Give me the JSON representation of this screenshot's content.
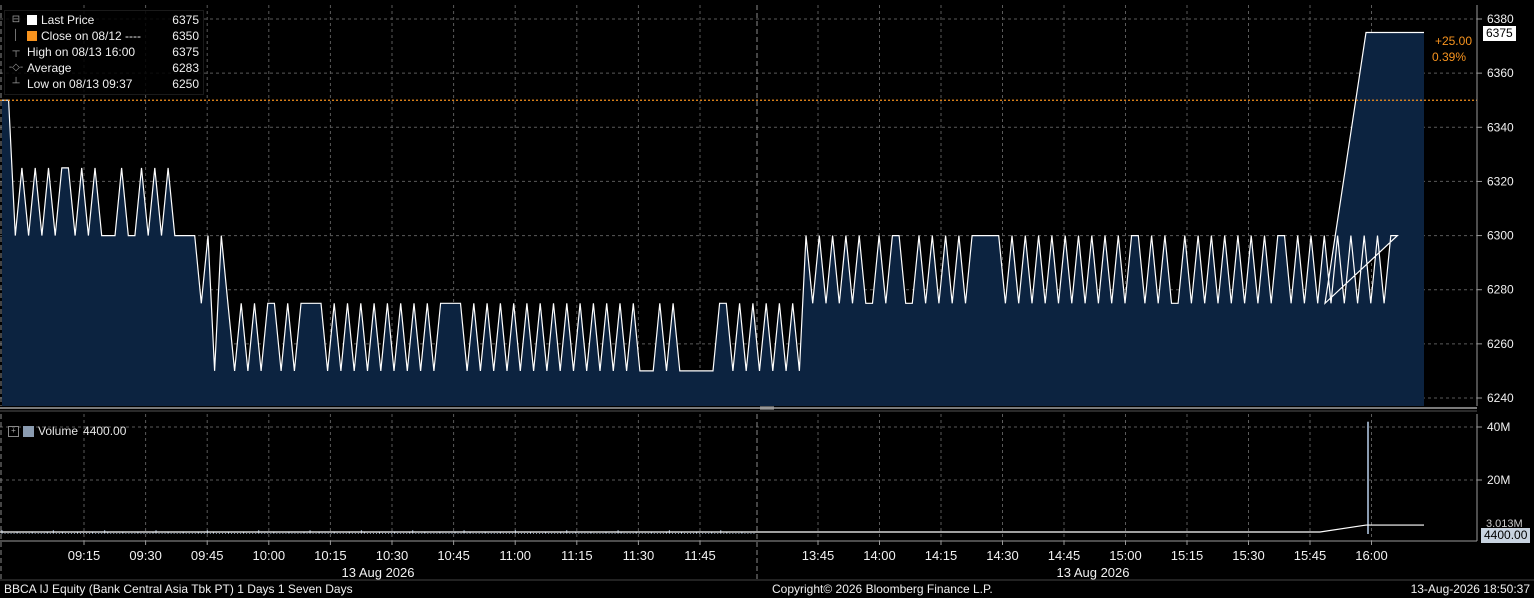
{
  "chart_data": [
    {
      "type": "area",
      "panel": "price",
      "ylim": [
        6236,
        6384
      ],
      "yticks": [
        6240,
        6260,
        6280,
        6300,
        6320,
        6340,
        6360,
        6380
      ],
      "series": [
        {
          "name": "Last Price",
          "color": "#ffffff",
          "fill": "#0c2340",
          "values": [
            6350,
            6350,
            6300,
            6325,
            6300,
            6325,
            6300,
            6325,
            6300,
            6325,
            6325,
            6300,
            6325,
            6300,
            6325,
            6300,
            6300,
            6300,
            6325,
            6300,
            6300,
            6325,
            6300,
            6325,
            6300,
            6325,
            6300,
            6300,
            6300,
            6300,
            6275,
            6300,
            6250,
            6300,
            6275,
            6250,
            6275,
            6250,
            6275,
            6250,
            6275,
            6275,
            6250,
            6275,
            6250,
            6275,
            6275,
            6275,
            6275,
            6250,
            6275,
            6250,
            6275,
            6250,
            6275,
            6250,
            6275,
            6250,
            6275,
            6250,
            6275,
            6250,
            6275,
            6250,
            6275,
            6250,
            6275,
            6275,
            6275,
            6275,
            6250,
            6275,
            6250,
            6275,
            6250,
            6275,
            6250,
            6275,
            6250,
            6275,
            6250,
            6275,
            6250,
            6275,
            6250,
            6275,
            6250,
            6275,
            6250,
            6275,
            6250,
            6275,
            6250,
            6275,
            6250,
            6275,
            6250,
            6250,
            6250,
            6275,
            6250,
            6275,
            6250,
            6250,
            6250,
            6250,
            6250,
            6250,
            6275,
            6275,
            6250,
            6275,
            6250,
            6275,
            6250,
            6275,
            6250,
            6275,
            6250,
            6275,
            6250,
            6300,
            6275,
            6300,
            6275,
            6300,
            6275,
            6300,
            6275,
            6300,
            6275,
            6275,
            6300,
            6275,
            6300,
            6300,
            6275,
            6275,
            6300,
            6275,
            6300,
            6275,
            6300,
            6275,
            6300,
            6275,
            6300,
            6300,
            6300,
            6300,
            6300,
            6275,
            6300,
            6275,
            6300,
            6275,
            6300,
            6275,
            6300,
            6275,
            6300,
            6275,
            6300,
            6275,
            6300,
            6275,
            6300,
            6275,
            6300,
            6275,
            6300,
            6300,
            6275,
            6300,
            6275,
            6300,
            6275,
            6275,
            6300,
            6275,
            6300,
            6275,
            6300,
            6275,
            6300,
            6275,
            6300,
            6275,
            6300,
            6275,
            6300,
            6275,
            6300,
            6300,
            6275,
            6300,
            6275,
            6300,
            6275,
            6300,
            6275,
            6300,
            6275,
            6300,
            6275,
            6300,
            6275,
            6300,
            6275,
            6300,
            6300,
            6275,
            6375,
            6375,
            6375
          ]
        }
      ],
      "reference_line": {
        "label": "Close on 08/12",
        "value": 6350,
        "color": "#f7931e"
      },
      "legend": [
        {
          "label": "Last Price",
          "value": "6375",
          "symbol": "white-square"
        },
        {
          "label": "Close on 08/12 ----",
          "value": "6350",
          "symbol": "orange-square"
        },
        {
          "label": "High on 08/13 16:00",
          "value": "6375",
          "symbol": "high-marker"
        },
        {
          "label": "Average",
          "value": "6283",
          "symbol": "average-marker"
        },
        {
          "label": "Low on 08/13 09:37",
          "value": "6250",
          "symbol": "low-marker"
        }
      ],
      "last_price_tag": "6375",
      "change": "+25.00",
      "change_pct": "0.39%"
    },
    {
      "type": "bar",
      "panel": "volume",
      "ylim": [
        0,
        45
      ],
      "yticks": [
        {
          "value": 20,
          "label": "20M"
        },
        {
          "value": 40,
          "label": "40M"
        }
      ],
      "series": [
        {
          "name": "Volume",
          "color": "#8a9bb0",
          "last_value": "4400.00",
          "spike_value": 42,
          "spike_position": 0.961,
          "running_value_label": "3.013M",
          "running_value": 3.0
        }
      ]
    }
  ],
  "x_axis": {
    "tick_labels": [
      "09:15",
      "09:30",
      "09:45",
      "10:00",
      "10:15",
      "10:30",
      "10:45",
      "11:00",
      "11:15",
      "11:30",
      "11:45",
      "13:45",
      "14:00",
      "14:15",
      "14:30",
      "14:45",
      "15:00",
      "15:15",
      "15:30",
      "15:45",
      "16:00"
    ],
    "date_labels": [
      "13 Aug 2026",
      "13 Aug 2026"
    ]
  },
  "footer": {
    "ticker": "BBCA IJ Equity (Bank Central Asia Tbk PT) 1 Days 1 Seven Days",
    "copyright": "Copyright© 2026 Bloomberg Finance L.P.",
    "timestamp": "13-Aug-2026 18:50:37"
  },
  "colors": {
    "background": "#000000",
    "grid": "#5a5a5a",
    "area": "#0c2340",
    "line": "#ffffff",
    "close": "#f7931e"
  }
}
